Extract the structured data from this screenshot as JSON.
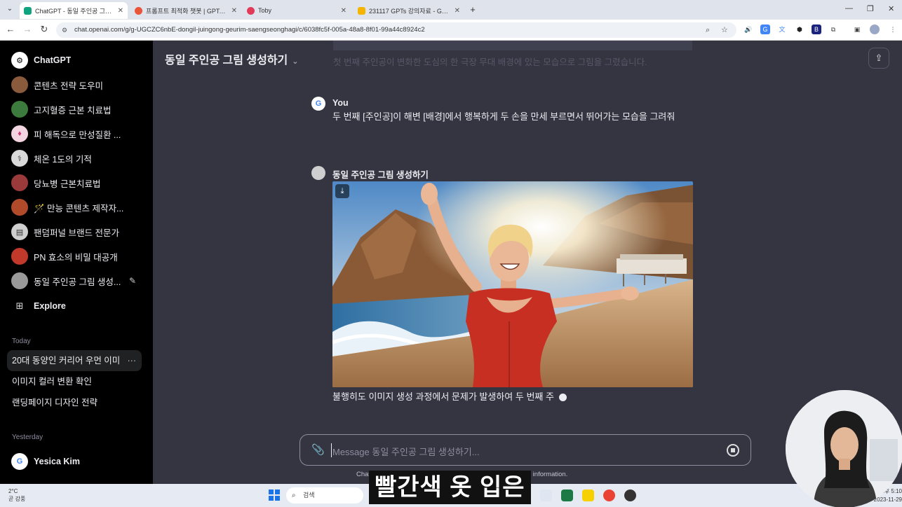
{
  "browser": {
    "tabs": [
      {
        "title": "ChatGPT - 동일 주인공 그림 생",
        "active": true,
        "favicon_color": "#10a37f"
      },
      {
        "title": "프롬프트 최적화 챗봇 | GPTers",
        "active": false,
        "favicon_color": "#e8553a"
      },
      {
        "title": "Toby",
        "active": false,
        "favicon_color": "#e23b5a"
      },
      {
        "title": "231117 GPTs 강의자료 - Goog",
        "active": false,
        "favicon_color": "#f4b400"
      }
    ],
    "tab_close": "✕",
    "new_tab": "+",
    "url": "chat.openai.com/g/g-UGCZC6nbE-dongil-juingong-geurim-saengseonghagi/c/6038fc5f-005a-48a8-8f01-99a44c8924c2"
  },
  "sidebar": {
    "top_items": [
      {
        "label": "ChatGPT",
        "icon": "openai-logo-icon",
        "color": "#ffffff"
      },
      {
        "label": "콘텐츠 전략 도우미",
        "icon": "gpt-avatar-icon",
        "color": "#8a5a3c"
      },
      {
        "label": "고지혈증 근본 치료법",
        "icon": "gpt-avatar-icon",
        "color": "#3d7a3d"
      },
      {
        "label": "피 해독으로 만성질환 ...",
        "icon": "gpt-avatar-icon",
        "color": "#c83a7a"
      },
      {
        "label": "체온 1도의 기적",
        "icon": "gpt-avatar-icon",
        "color": "#d9d9d9"
      },
      {
        "label": "당뇨병 근본치료법",
        "icon": "gpt-avatar-icon",
        "color": "#9a3a3a"
      },
      {
        "label": "🪄 만능 콘텐츠 제작자...",
        "icon": "gpt-avatar-icon",
        "color": "#b04a2a"
      },
      {
        "label": "팬덤퍼널 브랜드 전문가",
        "icon": "gpt-avatar-icon",
        "color": "#cfcfcf"
      },
      {
        "label": "PN 효소의 비밀 대공개",
        "icon": "gpt-avatar-icon",
        "color": "#c0392b"
      },
      {
        "label": "동일 주인공 그림 생성...",
        "icon": "gpt-avatar-icon",
        "color": "#9a9a9a"
      },
      {
        "label": "Explore",
        "icon": "grid-icon",
        "color": "#000000"
      }
    ],
    "section_today": "Today",
    "today": [
      {
        "label": "20대 동양인 커리어 우먼 이미",
        "selected": true
      },
      {
        "label": "이미지 컬러 변환 확인",
        "selected": false
      },
      {
        "label": "랜딩페이지 디자인 전략",
        "selected": false
      }
    ],
    "section_yesterday": "Yesterday",
    "user_name": "Yesica Kim"
  },
  "main": {
    "gpt_title": "동일 주인공 그림 생성하기",
    "faded_prev_text": "첫 번째 주인공이 변화한 도심의 한 극장 무대 배경에 있는 모습으로 그림을 그렸습니다.",
    "user_author": "You",
    "user_message": "두 번째 [주인공]이 해변 [배경]에서 행복하게 두 손을 만세 부르면서 뛰어가는 모습을 그려줘",
    "assistant_author": "동일 주인공 그림 생성하기",
    "assistant_message": "불행히도 이미지 생성 과정에서 문제가 발생하여 두 번째 주",
    "composer_placeholder": "Message 동일 주인공 그림 생성하기...",
    "disclaimer": "ChatGPT can make mistakes. Consider checking important information."
  },
  "taskbar": {
    "weather_temp": "2°C",
    "weather_desc": "곧 강풍",
    "search_label": "검색",
    "clock_time": "오후 5:10",
    "clock_date": "2023-11-29"
  },
  "overlay": {
    "subtitle": "빨간색 옷 입은"
  }
}
